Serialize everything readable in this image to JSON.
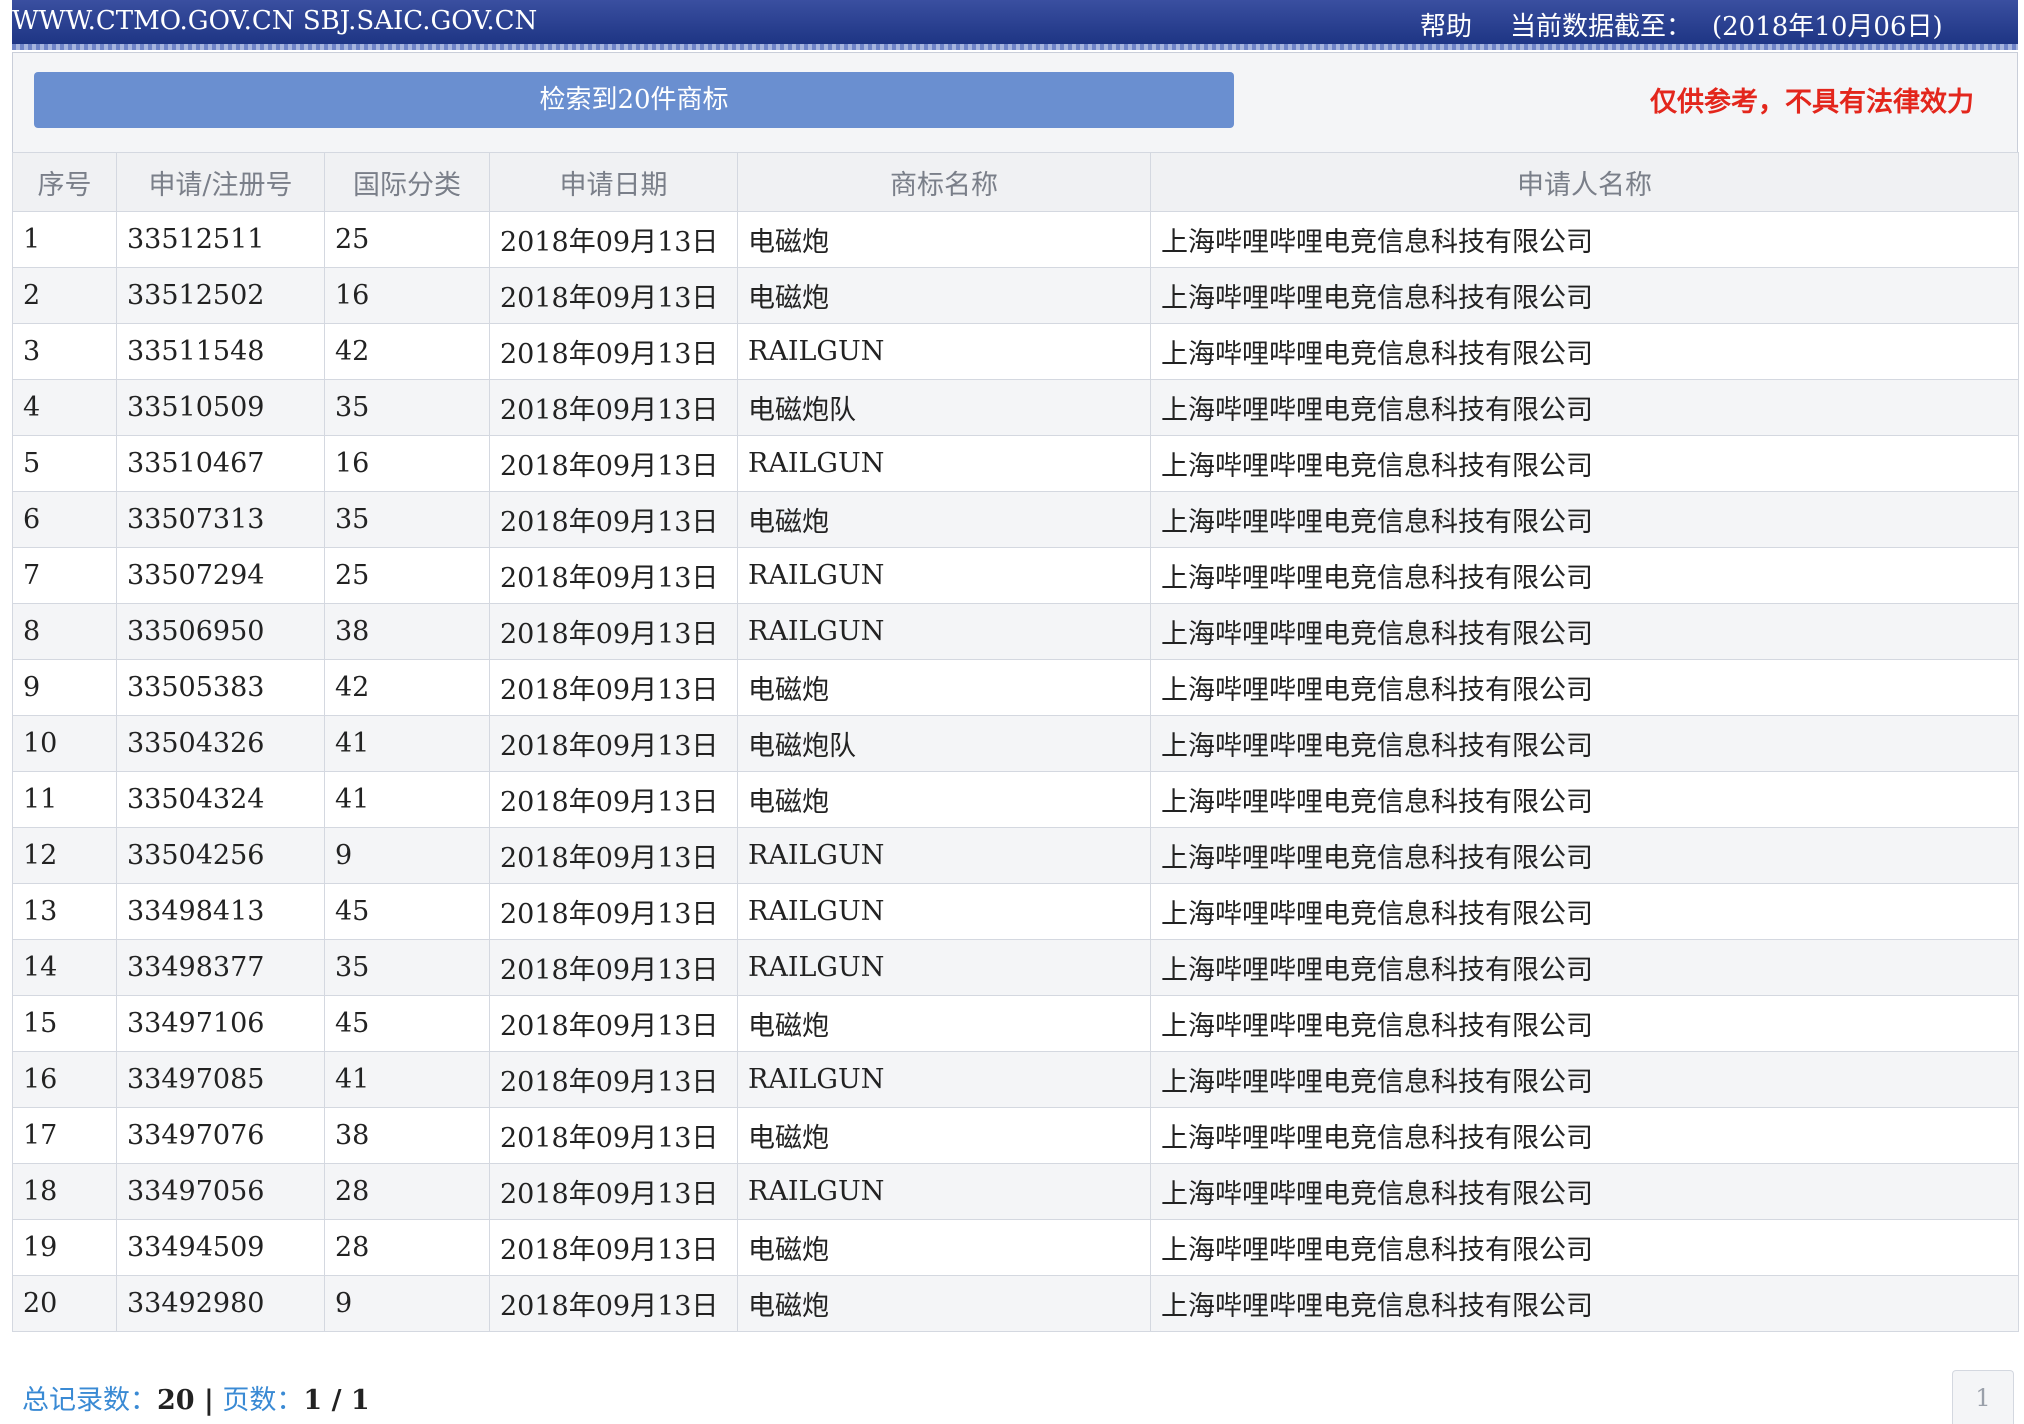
{
  "header": {
    "site": "WWW.CTMO.GOV.CN SBJ.SAIC.GOV.CN",
    "help": "帮助",
    "asof_label": "当前数据截至：",
    "asof_date": "(2018年10月06日)"
  },
  "result_bar": "检索到20件商标",
  "disclaimer": "仅供参考，不具有法律效力",
  "columns": [
    "序号",
    "申请/注册号",
    "国际分类",
    "申请日期",
    "商标名称",
    "申请人名称"
  ],
  "rows": [
    {
      "no": "1",
      "reg": "33512511",
      "cls": "25",
      "date": "2018年09月13日",
      "mark": "电磁炮",
      "applicant": "上海哔哩哔哩电竞信息科技有限公司"
    },
    {
      "no": "2",
      "reg": "33512502",
      "cls": "16",
      "date": "2018年09月13日",
      "mark": "电磁炮",
      "applicant": "上海哔哩哔哩电竞信息科技有限公司"
    },
    {
      "no": "3",
      "reg": "33511548",
      "cls": "42",
      "date": "2018年09月13日",
      "mark": "RAILGUN",
      "applicant": "上海哔哩哔哩电竞信息科技有限公司"
    },
    {
      "no": "4",
      "reg": "33510509",
      "cls": "35",
      "date": "2018年09月13日",
      "mark": "电磁炮队",
      "applicant": "上海哔哩哔哩电竞信息科技有限公司"
    },
    {
      "no": "5",
      "reg": "33510467",
      "cls": "16",
      "date": "2018年09月13日",
      "mark": "RAILGUN",
      "applicant": "上海哔哩哔哩电竞信息科技有限公司"
    },
    {
      "no": "6",
      "reg": "33507313",
      "cls": "35",
      "date": "2018年09月13日",
      "mark": "电磁炮",
      "applicant": "上海哔哩哔哩电竞信息科技有限公司"
    },
    {
      "no": "7",
      "reg": "33507294",
      "cls": "25",
      "date": "2018年09月13日",
      "mark": "RAILGUN",
      "applicant": "上海哔哩哔哩电竞信息科技有限公司"
    },
    {
      "no": "8",
      "reg": "33506950",
      "cls": "38",
      "date": "2018年09月13日",
      "mark": "RAILGUN",
      "applicant": "上海哔哩哔哩电竞信息科技有限公司"
    },
    {
      "no": "9",
      "reg": "33505383",
      "cls": "42",
      "date": "2018年09月13日",
      "mark": "电磁炮",
      "applicant": "上海哔哩哔哩电竞信息科技有限公司"
    },
    {
      "no": "10",
      "reg": "33504326",
      "cls": "41",
      "date": "2018年09月13日",
      "mark": "电磁炮队",
      "applicant": "上海哔哩哔哩电竞信息科技有限公司"
    },
    {
      "no": "11",
      "reg": "33504324",
      "cls": "41",
      "date": "2018年09月13日",
      "mark": "电磁炮",
      "applicant": "上海哔哩哔哩电竞信息科技有限公司"
    },
    {
      "no": "12",
      "reg": "33504256",
      "cls": "9",
      "date": "2018年09月13日",
      "mark": "RAILGUN",
      "applicant": "上海哔哩哔哩电竞信息科技有限公司"
    },
    {
      "no": "13",
      "reg": "33498413",
      "cls": "45",
      "date": "2018年09月13日",
      "mark": "RAILGUN",
      "applicant": "上海哔哩哔哩电竞信息科技有限公司"
    },
    {
      "no": "14",
      "reg": "33498377",
      "cls": "35",
      "date": "2018年09月13日",
      "mark": "RAILGUN",
      "applicant": "上海哔哩哔哩电竞信息科技有限公司"
    },
    {
      "no": "15",
      "reg": "33497106",
      "cls": "45",
      "date": "2018年09月13日",
      "mark": "电磁炮",
      "applicant": "上海哔哩哔哩电竞信息科技有限公司"
    },
    {
      "no": "16",
      "reg": "33497085",
      "cls": "41",
      "date": "2018年09月13日",
      "mark": "RAILGUN",
      "applicant": "上海哔哩哔哩电竞信息科技有限公司"
    },
    {
      "no": "17",
      "reg": "33497076",
      "cls": "38",
      "date": "2018年09月13日",
      "mark": "电磁炮",
      "applicant": "上海哔哩哔哩电竞信息科技有限公司"
    },
    {
      "no": "18",
      "reg": "33497056",
      "cls": "28",
      "date": "2018年09月13日",
      "mark": "RAILGUN",
      "applicant": "上海哔哩哔哩电竞信息科技有限公司"
    },
    {
      "no": "19",
      "reg": "33494509",
      "cls": "28",
      "date": "2018年09月13日",
      "mark": "电磁炮",
      "applicant": "上海哔哩哔哩电竞信息科技有限公司"
    },
    {
      "no": "20",
      "reg": "33492980",
      "cls": "9",
      "date": "2018年09月13日",
      "mark": "电磁炮",
      "applicant": "上海哔哩哔哩电竞信息科技有限公司"
    }
  ],
  "footer": {
    "total_label": "总记录数：",
    "total_value": "20",
    "separator": "|",
    "pages_label": "页数：",
    "pages_value": "1 / 1",
    "current_page": "1"
  },
  "colors": {
    "header_bg": "#1e3584",
    "result_bar_bg": "#6a8fd0",
    "link": "#2374bd",
    "disclaimer": "#e3261c"
  }
}
